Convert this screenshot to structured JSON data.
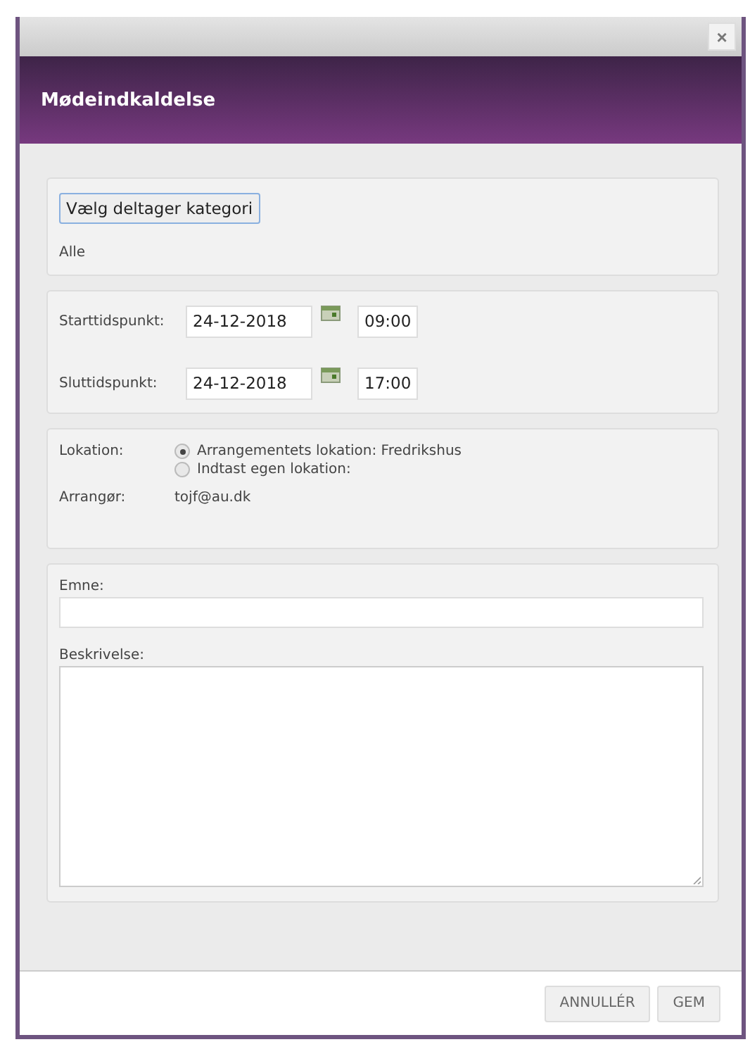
{
  "window": {
    "close": "×",
    "title": "Mødeindkaldelse"
  },
  "participants": {
    "button": "Vælg deltager kategori",
    "value": "Alle"
  },
  "times": [
    {
      "label": "Starttidspunkt:",
      "date": "24-12-2018",
      "time": "09:00"
    },
    {
      "label": "Sluttidspunkt:",
      "date": "24-12-2018",
      "time": "17:00"
    }
  ],
  "location": {
    "label": "Lokation:",
    "options": [
      {
        "label": "Arrangementets lokation:  Fredrikshus",
        "selected": true
      },
      {
        "label": "Indtast egen lokation:",
        "selected": false
      }
    ],
    "organizer_label": "Arrangør:",
    "organizer": "tojf@au.dk"
  },
  "subject": {
    "label": "Emne:"
  },
  "description": {
    "label": "Beskrivelse:"
  },
  "buttons": [
    "ANNULLÉR",
    "GEM"
  ]
}
